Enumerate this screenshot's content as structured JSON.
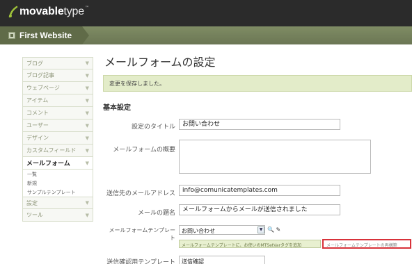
{
  "header": {
    "brand_bold": "movable",
    "brand_light": "type",
    "brand_tm": "™",
    "site_name": "First Website"
  },
  "sidebar": {
    "items": [
      {
        "label": "ブログ"
      },
      {
        "label": "ブログ記事"
      },
      {
        "label": "ウェブページ"
      },
      {
        "label": "アイテム"
      },
      {
        "label": "コメント"
      },
      {
        "label": "ユーザー"
      },
      {
        "label": "デザイン"
      },
      {
        "label": "カスタムフィールド"
      },
      {
        "label": "メールフォーム"
      }
    ],
    "subitems": [
      {
        "label": "一覧"
      },
      {
        "label": "新規"
      },
      {
        "label": "サンプルテンプレート"
      }
    ],
    "items_after": [
      {
        "label": "設定"
      },
      {
        "label": "ツール"
      }
    ]
  },
  "main": {
    "title": "メールフォームの設定",
    "message": "変更を保存しました。",
    "section": "基本設定",
    "fields": {
      "form_title_label": "設定のタイトル",
      "form_title_value": "お問い合わせ",
      "summary_label": "メールフォームの概要",
      "to_address_label": "送信先のメールアドレス",
      "to_address_value": "info@comunicatemplates.com",
      "subject_label": "メールの題名",
      "subject_value": "メールフォームからメールが送信されました",
      "template_label": "メールフォームテンプレート",
      "template_selected": "お問い合わせ",
      "template_link_icons": "🔍 ✎",
      "template_button_1": "メールフォームテンプレートに、お使いのMTSetVarタグを追加",
      "template_button_2": "メールフォームテンプレートの再構築",
      "confirm_label": "送信確認用テンプレート",
      "confirm_selected": "送信確認"
    }
  }
}
